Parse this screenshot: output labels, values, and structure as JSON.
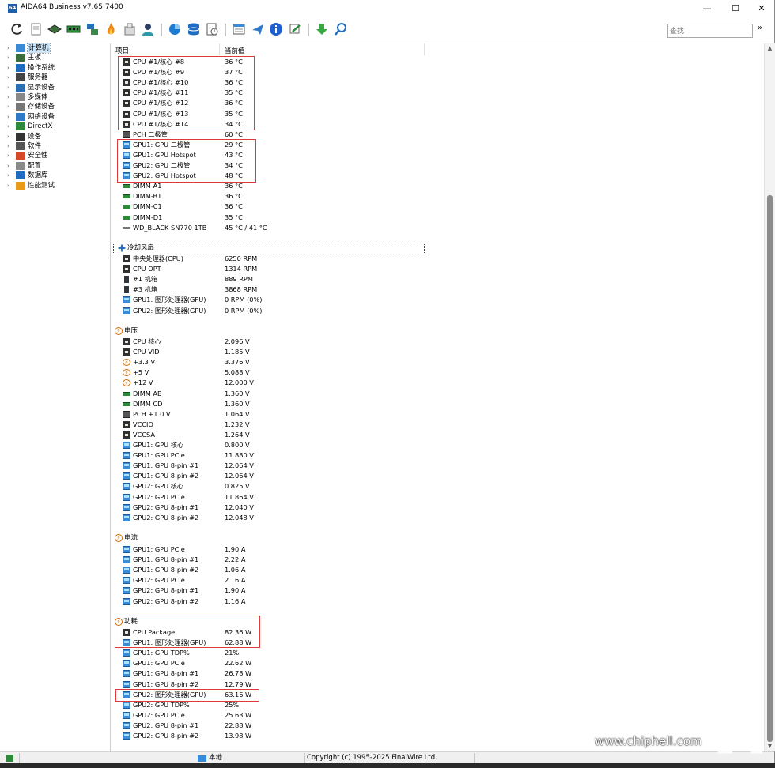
{
  "window": {
    "title": "AIDA64 Business v7.65.7400",
    "icon_text": "64",
    "minimize": "—",
    "maximize": "☐",
    "close": "✕"
  },
  "toolbar": {
    "search_placeholder": "查找",
    "more": "»",
    "icons": [
      "refresh-icon",
      "report-icon",
      "motherboard-icon",
      "memory-icon",
      "network-icon",
      "flame-icon",
      "package-icon",
      "user-icon",
      "chart-icon",
      "database-icon",
      "checklist-icon",
      "report-wizard-icon",
      "send-icon",
      "info-icon",
      "tools-icon",
      "download-icon",
      "search-icon"
    ]
  },
  "tree": {
    "items": [
      {
        "label": "计算机",
        "icon": "computer-icon",
        "selected": true
      },
      {
        "label": "主板",
        "icon": "motherboard-icon"
      },
      {
        "label": "操作系统",
        "icon": "windows-icon"
      },
      {
        "label": "服务器",
        "icon": "server-icon"
      },
      {
        "label": "显示设备",
        "icon": "display-icon"
      },
      {
        "label": "多媒体",
        "icon": "speaker-icon"
      },
      {
        "label": "存储设备",
        "icon": "storage-icon"
      },
      {
        "label": "网络设备",
        "icon": "network-icon"
      },
      {
        "label": "DirectX",
        "icon": "directx-icon"
      },
      {
        "label": "设备",
        "icon": "device-icon"
      },
      {
        "label": "软件",
        "icon": "software-icon"
      },
      {
        "label": "安全性",
        "icon": "shield-icon"
      },
      {
        "label": "配置",
        "icon": "config-icon"
      },
      {
        "label": "数据库",
        "icon": "database-icon"
      },
      {
        "label": "性能测试",
        "icon": "benchmark-icon"
      }
    ]
  },
  "list": {
    "col_item": "项目",
    "col_value": "当前值",
    "temperatures": [
      {
        "name": "CPU #1/核心 #8",
        "value": "36 °C",
        "icon": "cpu"
      },
      {
        "name": "CPU #1/核心 #9",
        "value": "37 °C",
        "icon": "cpu"
      },
      {
        "name": "CPU #1/核心 #10",
        "value": "36 °C",
        "icon": "cpu"
      },
      {
        "name": "CPU #1/核心 #11",
        "value": "35 °C",
        "icon": "cpu"
      },
      {
        "name": "CPU #1/核心 #12",
        "value": "36 °C",
        "icon": "cpu"
      },
      {
        "name": "CPU #1/核心 #13",
        "value": "35 °C",
        "icon": "cpu"
      },
      {
        "name": "CPU #1/核心 #14",
        "value": "34 °C",
        "icon": "cpu"
      },
      {
        "name": "PCH 二极管",
        "value": "60 °C",
        "icon": "pch"
      },
      {
        "name": "GPU1: GPU 二极管",
        "value": "29 °C",
        "icon": "gpu"
      },
      {
        "name": "GPU1: GPU Hotspot",
        "value": "43 °C",
        "icon": "gpu"
      },
      {
        "name": "GPU2: GPU 二极管",
        "value": "34 °C",
        "icon": "gpu"
      },
      {
        "name": "GPU2: GPU Hotspot",
        "value": "48 °C",
        "icon": "gpu"
      },
      {
        "name": "DIMM-A1",
        "value": "36 °C",
        "icon": "ram"
      },
      {
        "name": "DIMM-B1",
        "value": "36 °C",
        "icon": "ram"
      },
      {
        "name": "DIMM-C1",
        "value": "36 °C",
        "icon": "ram"
      },
      {
        "name": "DIMM-D1",
        "value": "35 °C",
        "icon": "ram"
      },
      {
        "name": "WD_BLACK SN770 1TB",
        "value": "45 °C / 41 °C",
        "icon": "disk"
      }
    ],
    "fans_title": "冷却风扇",
    "fans": [
      {
        "name": "中央处理器(CPU)",
        "value": "6250 RPM",
        "icon": "cpu"
      },
      {
        "name": "CPU OPT",
        "value": "1314 RPM",
        "icon": "cpu"
      },
      {
        "name": "#1 机箱",
        "value": "889 RPM",
        "icon": "case"
      },
      {
        "name": "#3 机箱",
        "value": "3868 RPM",
        "icon": "case"
      },
      {
        "name": "GPU1: 图形处理器(GPU)",
        "value": "0 RPM  (0%)",
        "icon": "gpu"
      },
      {
        "name": "GPU2: 图形处理器(GPU)",
        "value": "0 RPM  (0%)",
        "icon": "gpu"
      }
    ],
    "voltage_title": "电压",
    "voltages": [
      {
        "name": "CPU 核心",
        "value": "2.096 V",
        "icon": "cpu"
      },
      {
        "name": "CPU VID",
        "value": "1.185 V",
        "icon": "cpu"
      },
      {
        "name": "+3.3 V",
        "value": "3.376 V",
        "icon": "volt"
      },
      {
        "name": "+5 V",
        "value": "5.088 V",
        "icon": "volt"
      },
      {
        "name": "+12 V",
        "value": "12.000 V",
        "icon": "volt"
      },
      {
        "name": "DIMM AB",
        "value": "1.360 V",
        "icon": "ram"
      },
      {
        "name": "DIMM CD",
        "value": "1.360 V",
        "icon": "ram"
      },
      {
        "name": "PCH +1.0 V",
        "value": "1.064 V",
        "icon": "pch"
      },
      {
        "name": "VCCIO",
        "value": "1.232 V",
        "icon": "cpu"
      },
      {
        "name": "VCCSA",
        "value": "1.264 V",
        "icon": "cpu"
      },
      {
        "name": "GPU1: GPU 核心",
        "value": "0.800 V",
        "icon": "gpu"
      },
      {
        "name": "GPU1: GPU PCIe",
        "value": "11.880 V",
        "icon": "gpu"
      },
      {
        "name": "GPU1: GPU 8-pin #1",
        "value": "12.064 V",
        "icon": "gpu"
      },
      {
        "name": "GPU1: GPU 8-pin #2",
        "value": "12.064 V",
        "icon": "gpu"
      },
      {
        "name": "GPU2: GPU 核心",
        "value": "0.825 V",
        "icon": "gpu"
      },
      {
        "name": "GPU2: GPU PCIe",
        "value": "11.864 V",
        "icon": "gpu"
      },
      {
        "name": "GPU2: GPU 8-pin #1",
        "value": "12.040 V",
        "icon": "gpu"
      },
      {
        "name": "GPU2: GPU 8-pin #2",
        "value": "12.048 V",
        "icon": "gpu"
      }
    ],
    "current_title": "电流",
    "currents": [
      {
        "name": "GPU1: GPU PCIe",
        "value": "1.90 A",
        "icon": "gpu"
      },
      {
        "name": "GPU1: GPU 8-pin #1",
        "value": "2.22 A",
        "icon": "gpu"
      },
      {
        "name": "GPU1: GPU 8-pin #2",
        "value": "1.06 A",
        "icon": "gpu"
      },
      {
        "name": "GPU2: GPU PCIe",
        "value": "2.16 A",
        "icon": "gpu"
      },
      {
        "name": "GPU2: GPU 8-pin #1",
        "value": "1.90 A",
        "icon": "gpu"
      },
      {
        "name": "GPU2: GPU 8-pin #2",
        "value": "1.16 A",
        "icon": "gpu"
      }
    ],
    "power_title": "功耗",
    "powers": [
      {
        "name": "CPU Package",
        "value": "82.36 W",
        "icon": "cpu"
      },
      {
        "name": "GPU1: 图形处理器(GPU)",
        "value": "62.88 W",
        "icon": "gpu"
      },
      {
        "name": "GPU1: GPU TDP%",
        "value": "21%",
        "icon": "gpu"
      },
      {
        "name": "GPU1: GPU PCIe",
        "value": "22.62 W",
        "icon": "gpu"
      },
      {
        "name": "GPU1: GPU 8-pin #1",
        "value": "26.78 W",
        "icon": "gpu"
      },
      {
        "name": "GPU1: GPU 8-pin #2",
        "value": "12.79 W",
        "icon": "gpu"
      },
      {
        "name": "GPU2: 图形处理器(GPU)",
        "value": "63.16 W",
        "icon": "gpu"
      },
      {
        "name": "GPU2: GPU TDP%",
        "value": "25%",
        "icon": "gpu"
      },
      {
        "name": "GPU2: GPU PCIe",
        "value": "25.63 W",
        "icon": "gpu"
      },
      {
        "name": "GPU2: GPU 8-pin #1",
        "value": "22.88 W",
        "icon": "gpu"
      },
      {
        "name": "GPU2: GPU 8-pin #2",
        "value": "13.98 W",
        "icon": "gpu"
      }
    ]
  },
  "statusbar": {
    "location": "本地",
    "copyright": "Copyright (c) 1995-2025 FinalWire Ltd."
  },
  "watermark": {
    "text": "www.chiphell.com",
    "logo": "chiphell-logo"
  },
  "colors": {
    "highlight_box": "#e0393b",
    "selection": "#cce4f7"
  }
}
